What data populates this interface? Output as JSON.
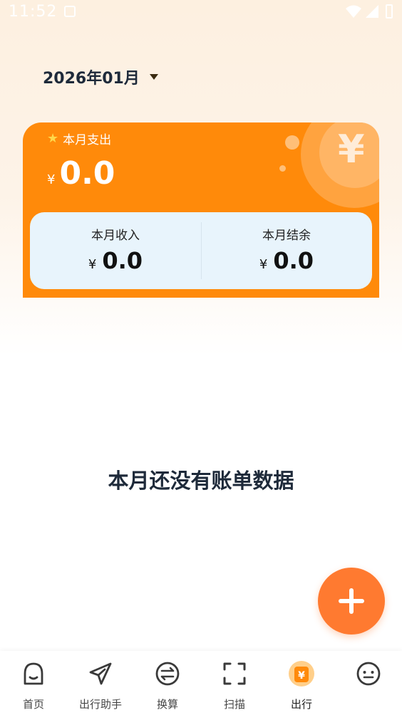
{
  "status_bar": {
    "time": "11:52"
  },
  "header": {
    "month_label": "2026年01月"
  },
  "summary_card": {
    "expense_label": "本月支出",
    "currency_symbol": "¥",
    "expense_amount": "0.0",
    "income_label": "本月收入",
    "income_amount": "0.0",
    "balance_label": "本月结余",
    "balance_amount": "0.0"
  },
  "empty_state": {
    "message": "本月还没有账单数据"
  },
  "fab": {
    "icon": "plus-icon"
  },
  "bottom_nav": {
    "items": [
      {
        "label": "首页",
        "icon": "home-icon"
      },
      {
        "label": "出行助手",
        "icon": "paper-plane-icon"
      },
      {
        "label": "换算",
        "icon": "exchange-icon"
      },
      {
        "label": "扫描",
        "icon": "scan-icon"
      },
      {
        "label": "出行",
        "icon": "bill-icon",
        "active": true
      },
      {
        "label": "",
        "icon": "face-icon"
      }
    ]
  },
  "colors": {
    "accent": "#ff8a0a",
    "fab": "#ff7a30",
    "panel": "#e8f4fc",
    "text_dark": "#1e2a3a"
  }
}
